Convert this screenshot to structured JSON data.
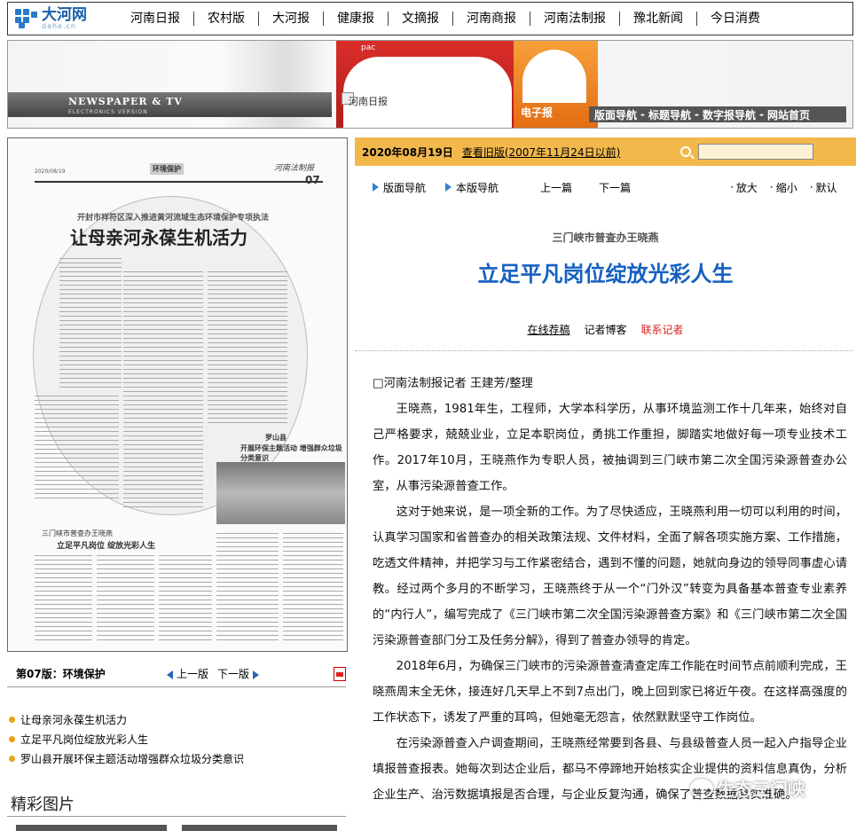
{
  "site": {
    "logo_cn": "大河网",
    "logo_en": "dahe.cn"
  },
  "topnav": [
    "河南日报",
    "农村版",
    "大河报",
    "健康报",
    "文摘报",
    "河南商报",
    "河南法制报",
    "豫北新闻",
    "今日消费"
  ],
  "banner": {
    "title1": "NEWSPAPER & TV",
    "title2": "ELECTRONICS VERSION",
    "pac": "pac",
    "paper_label": "河南日报",
    "epaper": "电子报",
    "subnav": [
      "版面导航",
      "-",
      "标题导航",
      "-",
      "数字报导航",
      "-",
      "网站首页"
    ]
  },
  "newspaper_page": {
    "date": "2020/08/19",
    "section": "环境保护",
    "brand": "河南法制报",
    "page_no": "07",
    "kicker": "开封市祥符区深入推进黄河流域生态环境保护专项执法",
    "headline": "让母亲河永葆生机活力",
    "sub1": "三门峡市普查办王晓燕",
    "sub2": "立足平凡岗位 绽放光彩人生",
    "sub3": "罗山县",
    "sub4": "开展环保主题活动 增强群众垃圾分类意识"
  },
  "page_meta": {
    "label": "第07版：环境保护",
    "prev": "上一版",
    "next": "下一版"
  },
  "articles": [
    "让母亲河永葆生机活力",
    "立足平凡岗位绽放光彩人生",
    "罗山县开展环保主题活动增强群众垃圾分类意识"
  ],
  "pics_title": "精彩图片",
  "datebar": {
    "date": "2020年08月19日",
    "old_link": "查看旧版(2007年11月24日以前)",
    "search_value": ""
  },
  "toolbar": {
    "page_nav": "版面导航",
    "this_nav": "本版导航",
    "prev": "上一篇",
    "next": "下一篇",
    "zoom_in": "放大",
    "zoom_out": "缩小",
    "default": "默认"
  },
  "article": {
    "byline_top": "三门峡市普查办王晓燕",
    "headline": "立足平凡岗位绽放光彩人生",
    "online": "在线荐稿",
    "blog": "记者博客",
    "contact": "联系记者",
    "paragraphs": [
      "□河南法制报记者 王建芳/整理",
      "王晓燕，1981年生，工程师，大学本科学历，从事环境监测工作十几年来，始终对自己严格要求，兢兢业业，立足本职岗位，勇挑工作重担，脚踏实地做好每一项专业技术工作。2017年10月，王晓燕作为专职人员，被抽调到三门峡市第二次全国污染源普查办公室，从事污染源普查工作。",
      "这对于她来说，是一项全新的工作。为了尽快适应，王晓燕利用一切可以利用的时间，认真学习国家和省普查办的相关政策法规、文件材料，全面了解各项实施方案、工作措施，吃透文件精神，并把学习与工作紧密结合，遇到不懂的问题，她就向身边的领导同事虚心请教。经过两个多月的不断学习，王晓燕终于从一个“门外汉”转变为具备基本普查专业素养的“内行人”，编写完成了《三门峡市第二次全国污染源普查方案》和《三门峡市第二次全国污染源普查部门分工及任务分解》，得到了普查办领导的肯定。",
      "2018年6月，为确保三门峡市的污染源普查清查定库工作能在时间节点前顺利完成，王晓燕周末全无休，接连好几天早上不到7点出门，晚上回到家已将近午夜。在这样高强度的工作状态下，诱发了严重的耳鸣，但她毫无怨言，依然默默坚守工作岗位。",
      "在污染源普查入户调查期间，王晓燕经常要到各县、与县级普查人员一起入户指导企业填报普查报表。她每次到达企业后，都马不停蹄地开始核实企业提供的资料信息真伪，分析企业生产、治污数据填报是否合理，与企业反复沟通，确保了普查数据真实准确。"
    ]
  },
  "watermark": "生态三门峡",
  "colors": {
    "accent_blue": "#1560c0",
    "datebar": "#f2b84c",
    "contact_red": "#dd2222"
  }
}
